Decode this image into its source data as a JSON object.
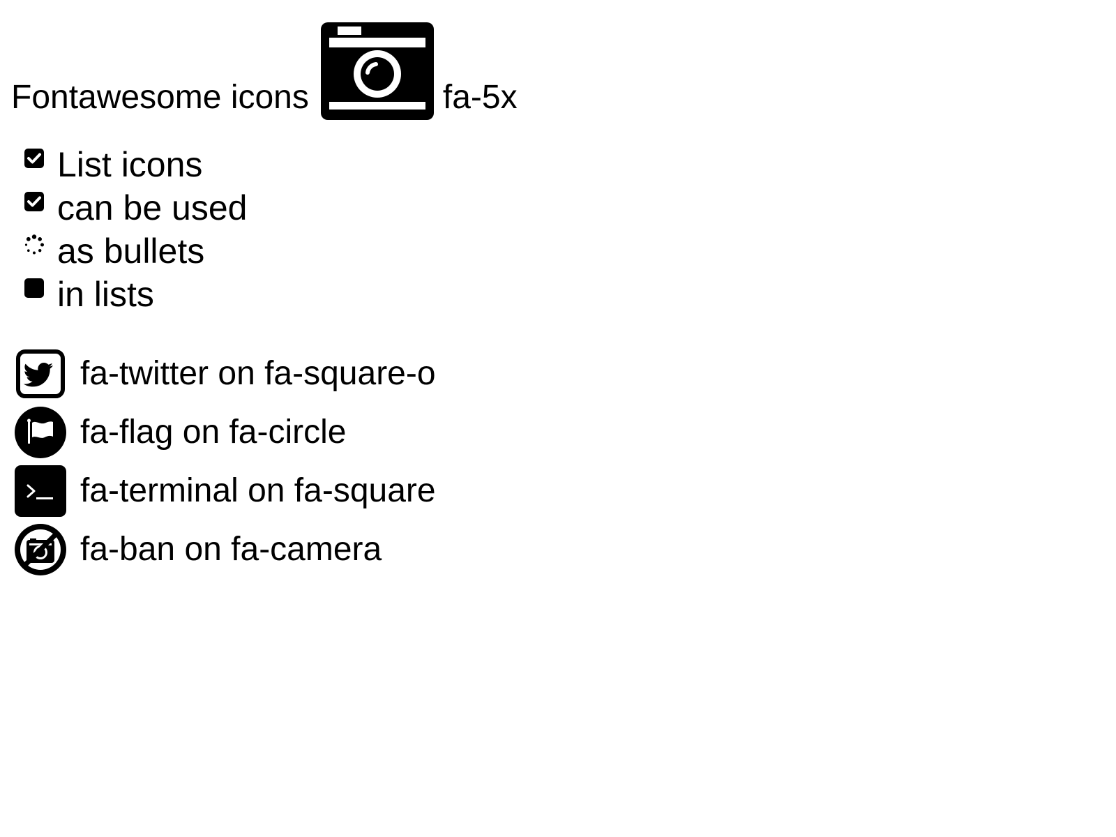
{
  "header": {
    "title": "Fontawesome icons",
    "icon": "camera-icon",
    "size_label": "fa-5x"
  },
  "list": {
    "items": [
      {
        "label": "List icons",
        "icon": "check-square-icon"
      },
      {
        "label": "can be used",
        "icon": "check-square-icon"
      },
      {
        "label": "as bullets",
        "icon": "spinner-icon"
      },
      {
        "label": "in lists",
        "icon": "square-icon"
      }
    ]
  },
  "stacks": {
    "rows": [
      {
        "label": "fa-twitter on fa-square-o",
        "icon": "twitter-on-square-outline-icon"
      },
      {
        "label": "fa-flag on fa-circle",
        "icon": "flag-on-circle-icon"
      },
      {
        "label": "fa-terminal on fa-square",
        "icon": "terminal-on-square-icon"
      },
      {
        "label": "fa-ban on fa-camera",
        "icon": "ban-on-camera-icon"
      }
    ]
  },
  "colors": {
    "foreground": "#000000",
    "background": "#ffffff"
  }
}
